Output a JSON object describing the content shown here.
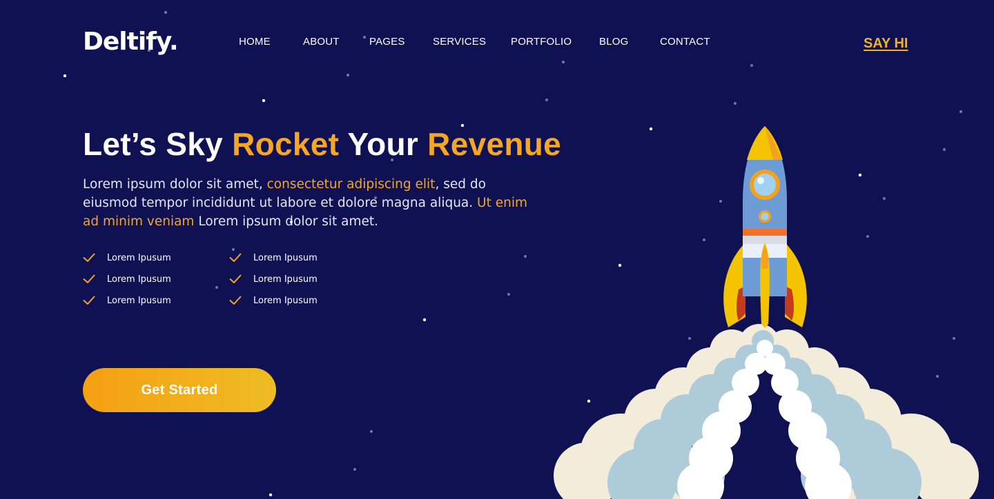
{
  "brand": {
    "logo": "Deltify."
  },
  "nav": {
    "items": [
      {
        "label": "HOME"
      },
      {
        "label": "ABOUT"
      },
      {
        "label": "PAGES"
      },
      {
        "label": "SERVICES"
      },
      {
        "label": "PORTFOLIO"
      },
      {
        "label": "BLOG"
      },
      {
        "label": "CONTACT"
      }
    ],
    "cta_label": "SAY HI"
  },
  "hero": {
    "title_parts": [
      "Let’s Sky ",
      "Rocket",
      " Your ",
      "Revenue"
    ],
    "description_parts": [
      "Lorem ipsum dolor sit amet, ",
      "consectetur adipiscing elit",
      ", sed do eiusmod tempor incididunt ut labore et dolore magna aliqua. ",
      "Ut enim ad minim veniam",
      " Lorem ipsum dolor sit amet."
    ],
    "features": [
      "Lorem Ipusum",
      "Lorem Ipusum",
      "Lorem Ipusum",
      "Lorem Ipusum",
      "Lorem Ipusum",
      "Lorem Ipusum"
    ],
    "button_label": "Get Started"
  },
  "illustration": {
    "subject": "rocket-launch-illustration",
    "objects": [
      "rocket",
      "smoke-clouds",
      "stars"
    ]
  },
  "colors": {
    "background": "#101153",
    "accent": "#f5a623",
    "button_gradient": [
      "#f5a012",
      "#eebc24"
    ],
    "text": "#ffffff"
  }
}
